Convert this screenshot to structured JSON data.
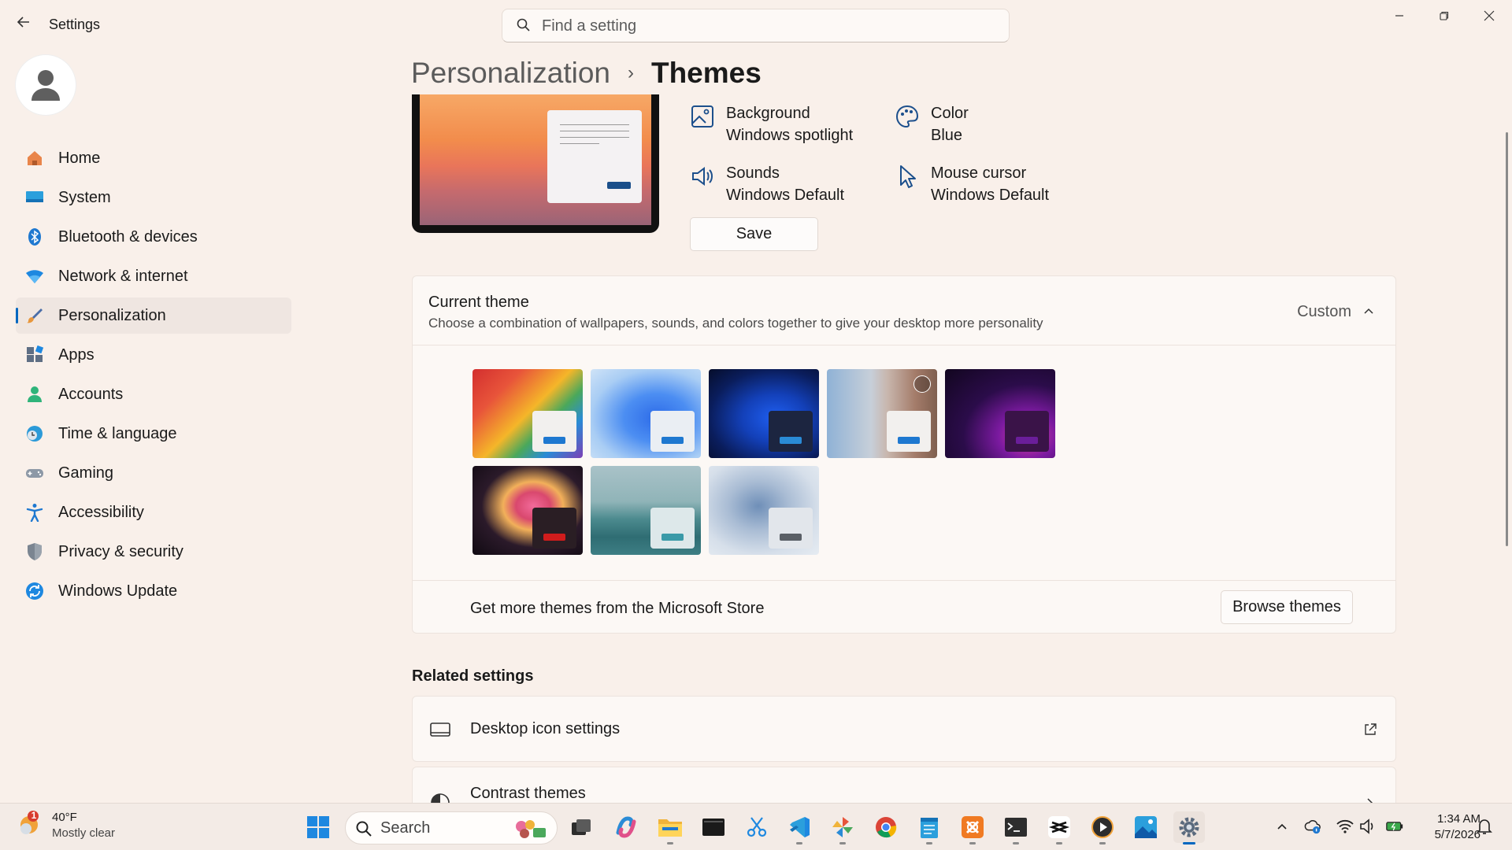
{
  "window": {
    "title": "Settings",
    "search_placeholder": "Find a setting"
  },
  "user": {
    "avatar": "person-icon"
  },
  "sidebar": {
    "items": [
      {
        "label": "Home",
        "icon": "home-icon",
        "selected": false
      },
      {
        "label": "System",
        "icon": "system-icon",
        "selected": false
      },
      {
        "label": "Bluetooth & devices",
        "icon": "bluetooth-icon",
        "selected": false
      },
      {
        "label": "Network & internet",
        "icon": "wifi-icon",
        "selected": false
      },
      {
        "label": "Personalization",
        "icon": "brush-icon",
        "selected": true
      },
      {
        "label": "Apps",
        "icon": "apps-icon",
        "selected": false
      },
      {
        "label": "Accounts",
        "icon": "account-icon",
        "selected": false
      },
      {
        "label": "Time & language",
        "icon": "globe-clock-icon",
        "selected": false
      },
      {
        "label": "Gaming",
        "icon": "gamepad-icon",
        "selected": false
      },
      {
        "label": "Accessibility",
        "icon": "accessibility-icon",
        "selected": false
      },
      {
        "label": "Privacy & security",
        "icon": "shield-icon",
        "selected": false
      },
      {
        "label": "Windows Update",
        "icon": "update-icon",
        "selected": false
      }
    ]
  },
  "breadcrumb": {
    "parent": "Personalization",
    "separator": "›",
    "current": "Themes"
  },
  "theme_props": {
    "background": {
      "label": "Background",
      "value": "Windows spotlight"
    },
    "color": {
      "label": "Color",
      "value": "Blue"
    },
    "sounds": {
      "label": "Sounds",
      "value": "Windows Default"
    },
    "cursor": {
      "label": "Mouse cursor",
      "value": "Windows Default"
    },
    "save_label": "Save"
  },
  "current_theme": {
    "title": "Current theme",
    "description": "Choose a combination of wallpapers, sounds, and colors together to give your desktop more personality",
    "value": "Custom",
    "store_text": "Get more themes from the Microsoft Store",
    "browse_label": "Browse themes"
  },
  "related": {
    "title": "Related settings",
    "rows": [
      {
        "label": "Desktop icon settings",
        "icon": "monitor-icon",
        "right_icon": "open-external-icon"
      },
      {
        "label": "Contrast themes",
        "icon": "contrast-icon",
        "right_icon": "chevron-right-icon"
      }
    ]
  },
  "taskbar": {
    "weather_temp": "40°F",
    "weather_condition": "Mostly clear",
    "weather_badge": "1",
    "search_label": "Search",
    "time": "1:34 AM",
    "date": "5/7/2026"
  },
  "colors": {
    "accent": "#0067c0",
    "background": "#f9f0ea",
    "card": "#fcf8f5"
  }
}
